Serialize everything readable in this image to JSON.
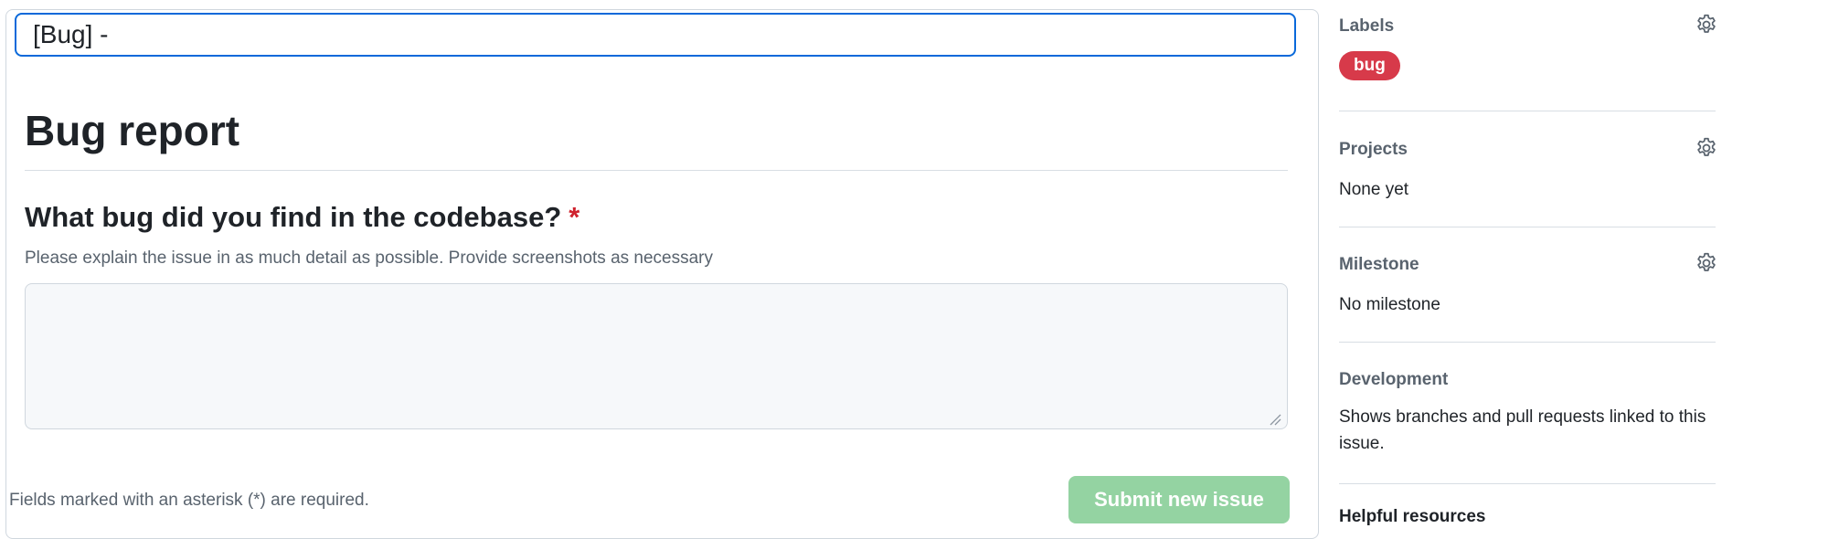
{
  "form": {
    "title_value": "[Bug] -",
    "heading": "Bug report",
    "question": {
      "label": "What bug did you find in the codebase?",
      "required_mark": "*",
      "help": "Please explain the issue in as much detail as possible. Provide screenshots as necessary",
      "value": ""
    },
    "required_note": "Fields marked with an asterisk (*) are required.",
    "submit_label": "Submit new issue"
  },
  "sidebar": {
    "labels": {
      "heading": "Labels",
      "items": [
        "bug"
      ]
    },
    "projects": {
      "heading": "Projects",
      "value": "None yet"
    },
    "milestone": {
      "heading": "Milestone",
      "value": "No milestone"
    },
    "development": {
      "heading": "Development",
      "value": "Shows branches and pull requests linked to this issue."
    },
    "helpful": {
      "heading": "Helpful resources"
    }
  },
  "colors": {
    "focus_border": "#0969da",
    "required": "#cf222e",
    "bug_label": "#d73a4a",
    "submit_disabled": "#94d3a2"
  },
  "icons": {
    "settings": "gear-icon",
    "resize": "resize-handle-icon"
  }
}
